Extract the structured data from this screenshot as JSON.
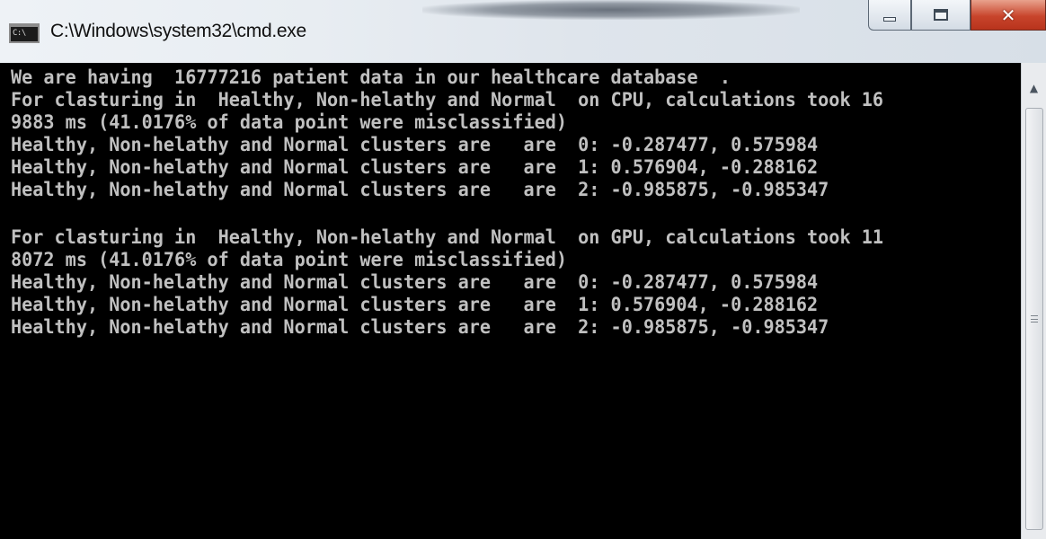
{
  "window": {
    "title": "C:\\Windows\\system32\\cmd.exe",
    "icon_text": "C:\\"
  },
  "console": {
    "lines": [
      "We are having  16777216 patient data in our healthcare database  .",
      "For clasturing in  Healthy, Non-helathy and Normal  on CPU, calculations took 16",
      "9883 ms (41.0176% of data point were misclassified)",
      "Healthy, Non-helathy and Normal clusters are   are  0: -0.287477, 0.575984",
      "Healthy, Non-helathy and Normal clusters are   are  1: 0.576904, -0.288162",
      "Healthy, Non-helathy and Normal clusters are   are  2: -0.985875, -0.985347",
      "",
      "For clasturing in  Healthy, Non-helathy and Normal  on GPU, calculations took 11",
      "8072 ms (41.0176% of data point were misclassified)",
      "Healthy, Non-helathy and Normal clusters are   are  0: -0.287477, 0.575984",
      "Healthy, Non-helathy and Normal clusters are   are  1: 0.576904, -0.288162",
      "Healthy, Non-helathy and Normal clusters are   are  2: -0.985875, -0.985347"
    ]
  },
  "colors": {
    "console_bg": "#000000",
    "console_text": "#c0c0c0",
    "close_button": "#c8452c"
  },
  "icons": {
    "app": "cmd-app-icon",
    "minimize": "minimize-icon",
    "maximize": "maximize-icon",
    "close": "close-icon",
    "scroll_up": "scroll-up-arrow-icon",
    "grip": "scroll-grip-icon"
  }
}
